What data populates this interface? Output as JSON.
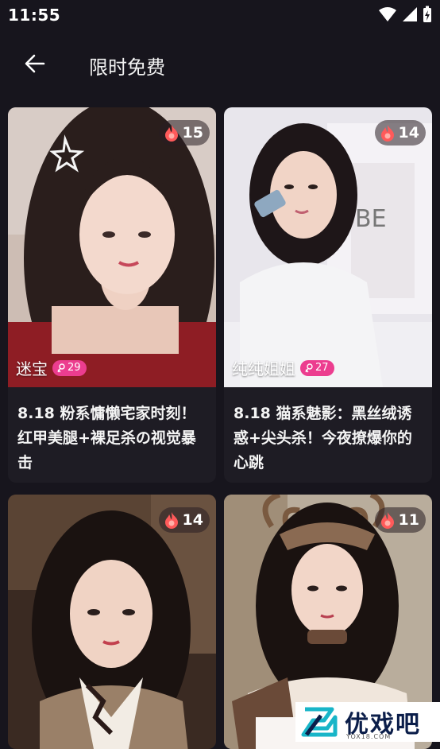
{
  "status_bar": {
    "time": "11:55"
  },
  "app_bar": {
    "title": "限时免费",
    "back_icon": "arrow-left-icon"
  },
  "cards": [
    {
      "heat": "15",
      "author": "迷宝",
      "fans": "29",
      "caption": "8.18 粉系慵懒宅家时刻！红甲美腿+裸足杀の视觉暴击"
    },
    {
      "heat": "14",
      "author": "纯纯姐姐",
      "fans": "27",
      "caption": "8.18 猫系魅影：黑丝绒诱惑+尖头杀！今夜撩爆你的心跳"
    },
    {
      "heat": "14",
      "author": "",
      "fans": "",
      "caption": ""
    },
    {
      "heat": "11",
      "author": "",
      "fans": "",
      "caption": ""
    }
  ],
  "watermark": {
    "name": "优戏吧",
    "domain": "YOX18.COM"
  },
  "colors": {
    "background": "#17151d",
    "card": "#1e1c24",
    "fans_badge": "#ec3d8f",
    "flame": "#ff5a5a"
  }
}
